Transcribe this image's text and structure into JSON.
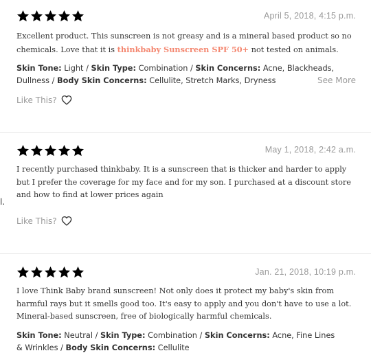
{
  "colors": {
    "star": "#f48770",
    "link": "#f48770",
    "muted": "#999999",
    "text": "#333333"
  },
  "reviews": [
    {
      "rating": 5,
      "date": "April 5, 2018, 4:15 p.m.",
      "text_before": "Excellent product. This sunscreen is not greasy and is a mineral based product so no chemicals. Love that it is ",
      "product_link": "thinkbaby Sunscreen SPF 50+",
      "text_after": " not tested on animals.",
      "skin_tone_label": "Skin Tone:",
      "skin_tone": "Light",
      "skin_type_label": "Skin Type:",
      "skin_type": "Combination",
      "skin_concerns_label": "Skin Concerns:",
      "skin_concerns": "Acne, Blackheads, Dullness",
      "body_concerns_label": "Body Skin Concerns:",
      "body_concerns": "Cellulite, Stretch Marks, Dryness",
      "see_more": "See More",
      "like_label": "Like This?"
    },
    {
      "rating": 5,
      "date": "May 1, 2018, 2:42 a.m.",
      "text": "I recently purchased thinkbaby. It is a sunscreen that is thicker and harder to apply but I prefer the coverage for my face and for my son. I purchased at a discount store and how to find at lower prices again",
      "like_label": "Like This?"
    },
    {
      "rating": 5,
      "date": "Jan. 21, 2018, 10:19 p.m.",
      "text": "I love Think Baby brand sunscreen! Not only does it protect my baby's skin from harmful rays but it smells good too. It's easy to apply and you don't have to use a lot. Mineral-based sunscreen, free of biologically harmful chemicals.",
      "skin_tone_label": "Skin Tone:",
      "skin_tone": "Neutral",
      "skin_type_label": "Skin Type:",
      "skin_type": "Combination",
      "skin_concerns_label": "Skin Concerns:",
      "skin_concerns": "Acne, Fine Lines & Wrinkles",
      "body_concerns_label": "Body Skin Concerns:",
      "body_concerns": "Cellulite"
    }
  ],
  "stray_mark": "l."
}
